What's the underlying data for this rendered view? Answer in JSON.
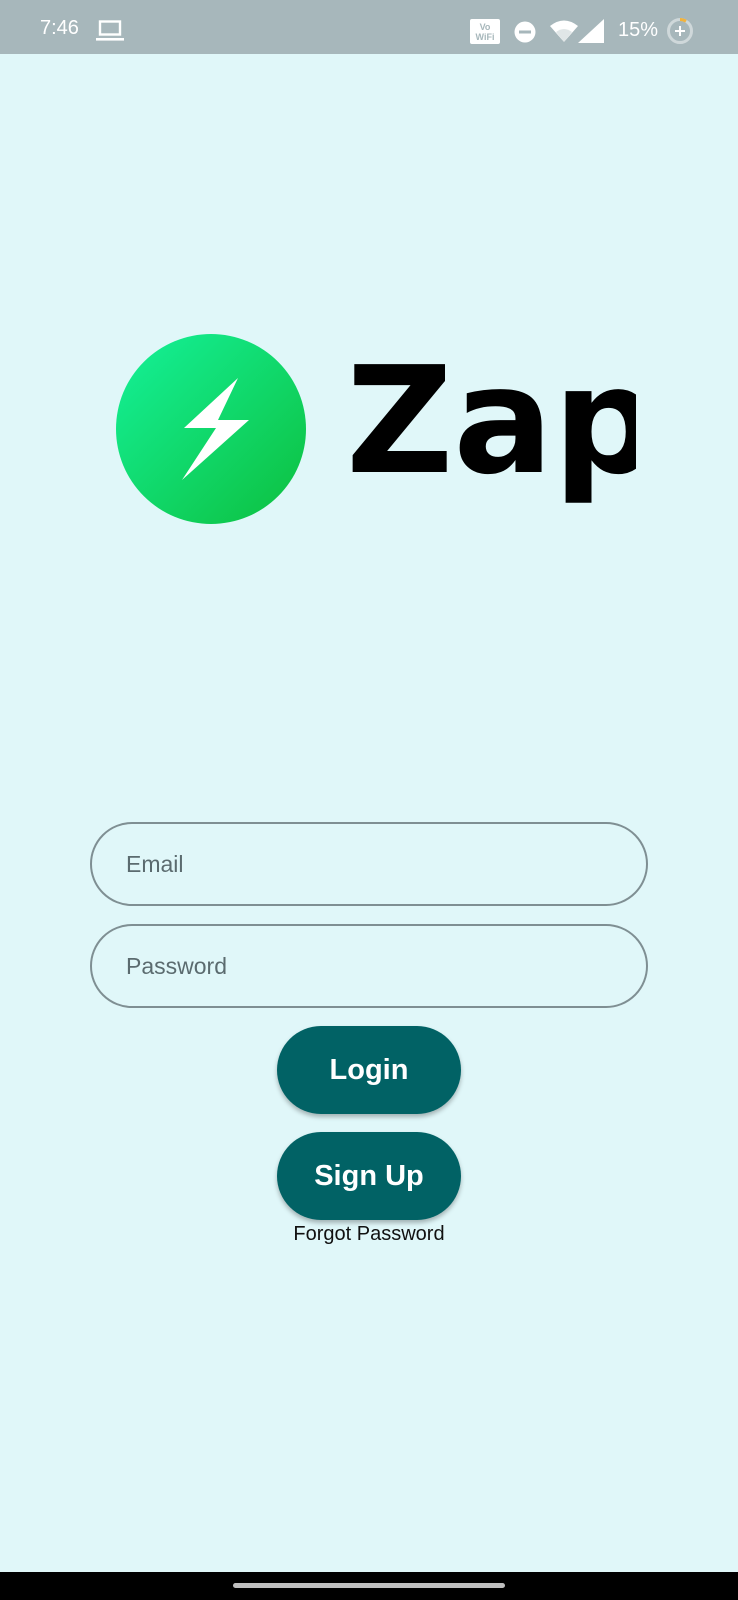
{
  "status_bar": {
    "time": "7:46",
    "battery_percent": "15%",
    "background_color": "#a7b7bb",
    "icons": [
      "laptop-icon",
      "vowifi-icon",
      "do-not-disturb-icon",
      "wifi-icon",
      "cell-signal-icon",
      "battery-saver-icon"
    ]
  },
  "logo": {
    "wordmark": "Zap",
    "emblem_icon": "lightning-bolt-icon",
    "gradient_colors": [
      "#14f29a",
      "#0dbf3d"
    ]
  },
  "login_form": {
    "email_placeholder": "Email",
    "password_placeholder": "Password",
    "login_label": "Login",
    "signup_label": "Sign Up",
    "forgot_password_label": "Forgot Password"
  },
  "theme": {
    "background": "#e0f7f9",
    "button_color": "#016265",
    "field_border": "#7f8f93"
  }
}
